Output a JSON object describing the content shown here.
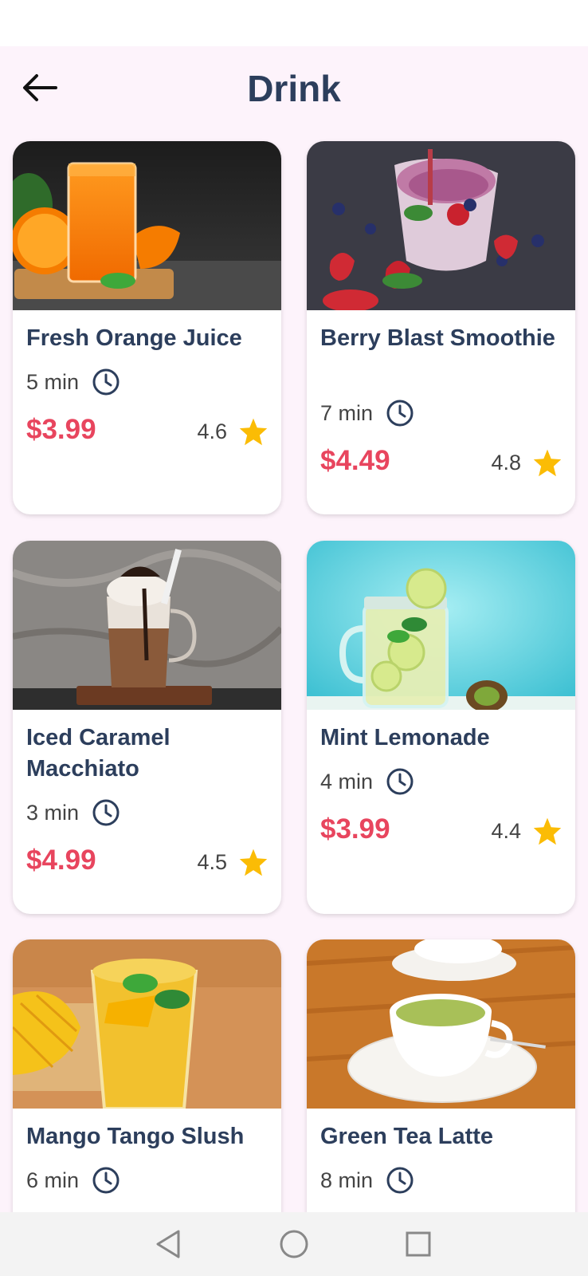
{
  "header": {
    "title": "Drink"
  },
  "drinks": [
    {
      "name": "Fresh Orange Juice",
      "time": "5 min",
      "price": "$3.99",
      "rating": "4.6"
    },
    {
      "name": "Berry Blast Smoothie",
      "time": "7 min",
      "price": "$4.49",
      "rating": "4.8"
    },
    {
      "name": "Iced Caramel Macchiato",
      "time": "3 min",
      "price": "$4.99",
      "rating": "4.5"
    },
    {
      "name": "Mint Lemonade",
      "time": "4 min",
      "price": "$3.99",
      "rating": "4.4"
    },
    {
      "name": "Mango Tango Slush",
      "time": "6 min",
      "price": "",
      "rating": ""
    },
    {
      "name": "Green Tea Latte",
      "time": "8 min",
      "price": "",
      "rating": ""
    }
  ],
  "colors": {
    "background": "#fdf3fb",
    "title": "#2c3e5c",
    "price": "#e8455e",
    "star": "#fbbc05"
  },
  "icons": {
    "back": "arrow-left-icon",
    "time": "clock-icon",
    "rating": "star-icon",
    "nav_back": "triangle-back-icon",
    "nav_home": "circle-home-icon",
    "nav_recent": "square-recents-icon"
  }
}
